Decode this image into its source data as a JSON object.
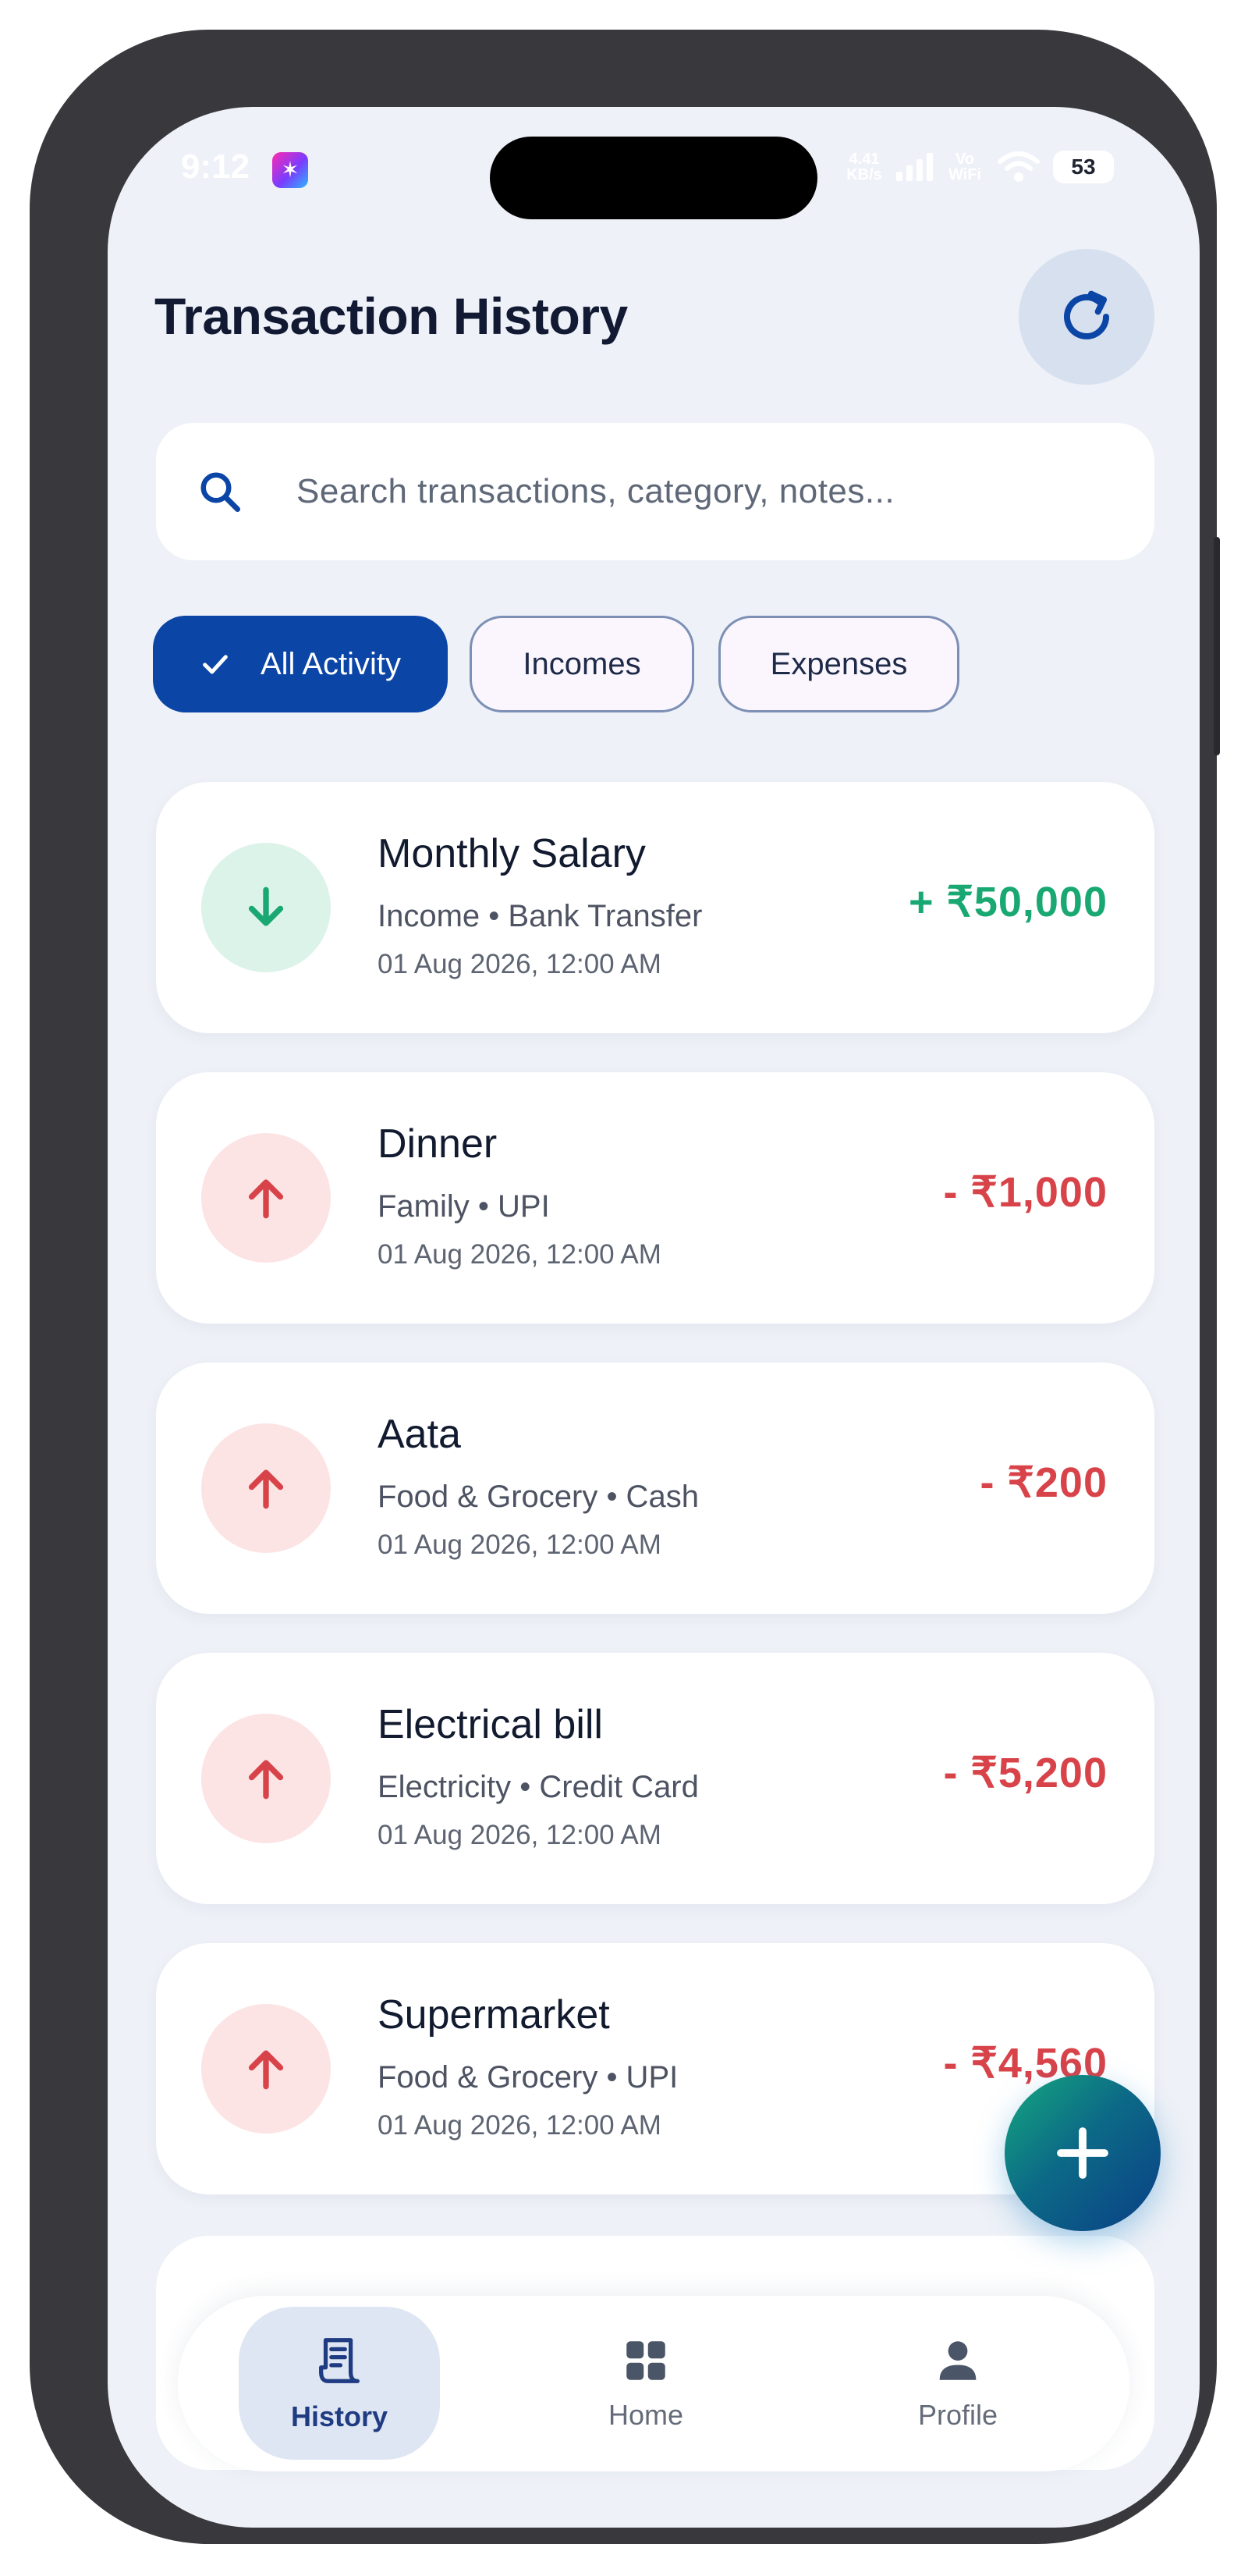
{
  "status_bar": {
    "time": "9:12",
    "network": "4.41 KB/s",
    "wifi_label": "Vo WiFi",
    "battery": "53"
  },
  "header": {
    "title": "Transaction History"
  },
  "search": {
    "placeholder": "Search transactions, category, notes..."
  },
  "filters": [
    {
      "label": "All Activity",
      "selected": true
    },
    {
      "label": "Incomes",
      "selected": false
    },
    {
      "label": "Expenses",
      "selected": false
    }
  ],
  "transactions": [
    {
      "title": "Monthly Salary",
      "category": "Income",
      "method": "Bank Transfer",
      "meta": "Income • Bank Transfer",
      "date": "01 Aug 2026, 12:00 AM",
      "amount": "+ ₹50,000",
      "type": "income"
    },
    {
      "title": "Dinner",
      "category": "Family",
      "method": "UPI",
      "meta": "Family • UPI",
      "date": "01 Aug 2026, 12:00 AM",
      "amount": "- ₹1,000",
      "type": "expense"
    },
    {
      "title": "Aata",
      "category": "Food & Grocery",
      "method": "Cash",
      "meta": "Food & Grocery • Cash",
      "date": "01 Aug 2026, 12:00 AM",
      "amount": "- ₹200",
      "type": "expense"
    },
    {
      "title": "Electrical bill",
      "category": "Electricity",
      "method": "Credit Card",
      "meta": "Electricity • Credit Card",
      "date": "01 Aug 2026, 12:00 AM",
      "amount": "- ₹5,200",
      "type": "expense"
    },
    {
      "title": "Supermarket",
      "category": "Food & Grocery",
      "method": "UPI",
      "meta": "Food & Grocery • UPI",
      "date": "01 Aug 2026, 12:00 AM",
      "amount": "- ₹4,560",
      "type": "expense"
    }
  ],
  "bottom_nav": [
    {
      "label": "History",
      "icon": "receipt-icon",
      "active": true
    },
    {
      "label": "Home",
      "icon": "grid-icon",
      "active": false
    },
    {
      "label": "Profile",
      "icon": "person-icon",
      "active": false
    }
  ],
  "colors": {
    "primary": "#0b45a6",
    "income": "#19a872",
    "expense": "#d8434a",
    "background": "#eef1f7",
    "fab_gradient_start": "#15a87f",
    "fab_gradient_end": "#0a3f86"
  },
  "icons": {
    "refresh": "refresh-icon",
    "search": "search-icon",
    "check": "check-icon",
    "income_arrow": "arrow-down-icon",
    "expense_arrow": "arrow-up-icon",
    "fab": "plus-icon"
  }
}
